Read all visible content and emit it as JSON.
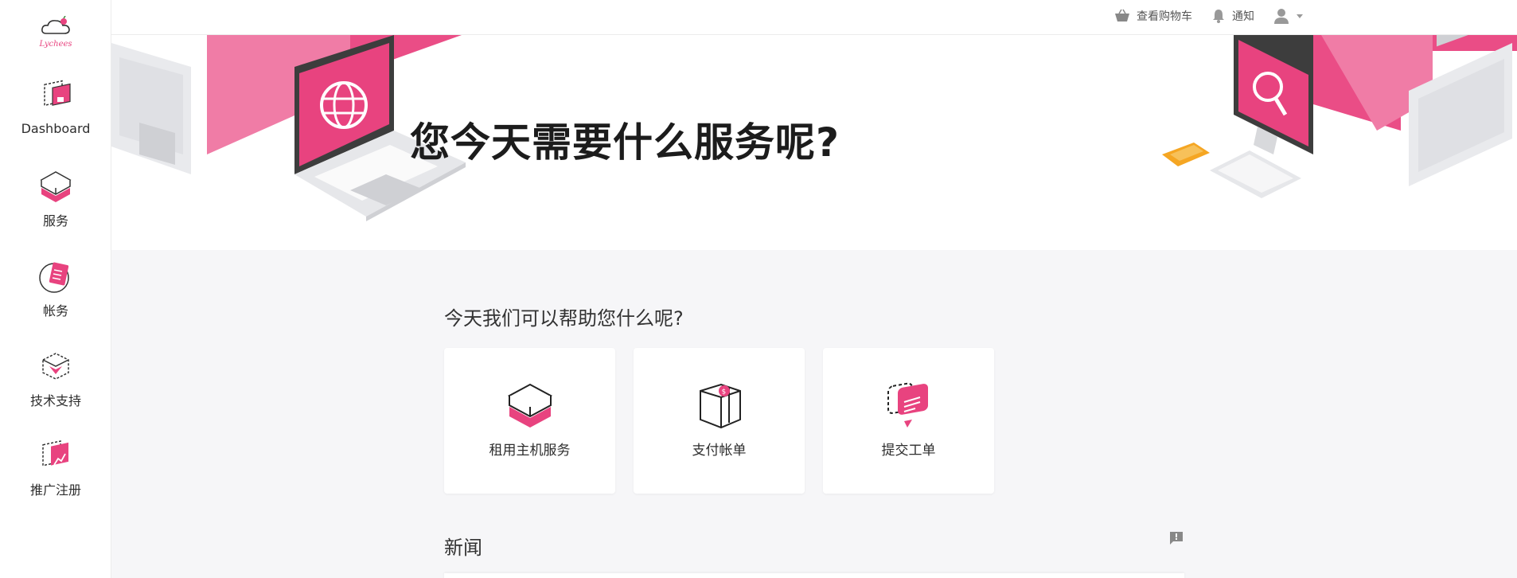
{
  "brand": {
    "logo_text": "Lychees",
    "accent": "#e8437f"
  },
  "sidebar": {
    "items": [
      {
        "label": "Dashboard",
        "icon": "dashboard-icon"
      },
      {
        "label": "服务",
        "icon": "server-box-icon"
      },
      {
        "label": "帐务",
        "icon": "billing-icon"
      },
      {
        "label": "技术支持",
        "icon": "support-box-icon"
      },
      {
        "label": "推广注册",
        "icon": "affiliate-chart-icon"
      }
    ]
  },
  "topbar": {
    "cart_label": "查看购物车",
    "notifications_label": "通知",
    "user_icon": "user-icon"
  },
  "hero": {
    "title": "您今天需要什么服务呢?"
  },
  "main": {
    "help_heading": "今天我们可以帮助您什么呢?",
    "cards": [
      {
        "label": "租用主机服务",
        "icon": "server-box-icon"
      },
      {
        "label": "支付帐单",
        "icon": "payment-box-icon"
      },
      {
        "label": "提交工单",
        "icon": "ticket-chat-icon"
      }
    ],
    "news_heading": "新闻"
  }
}
